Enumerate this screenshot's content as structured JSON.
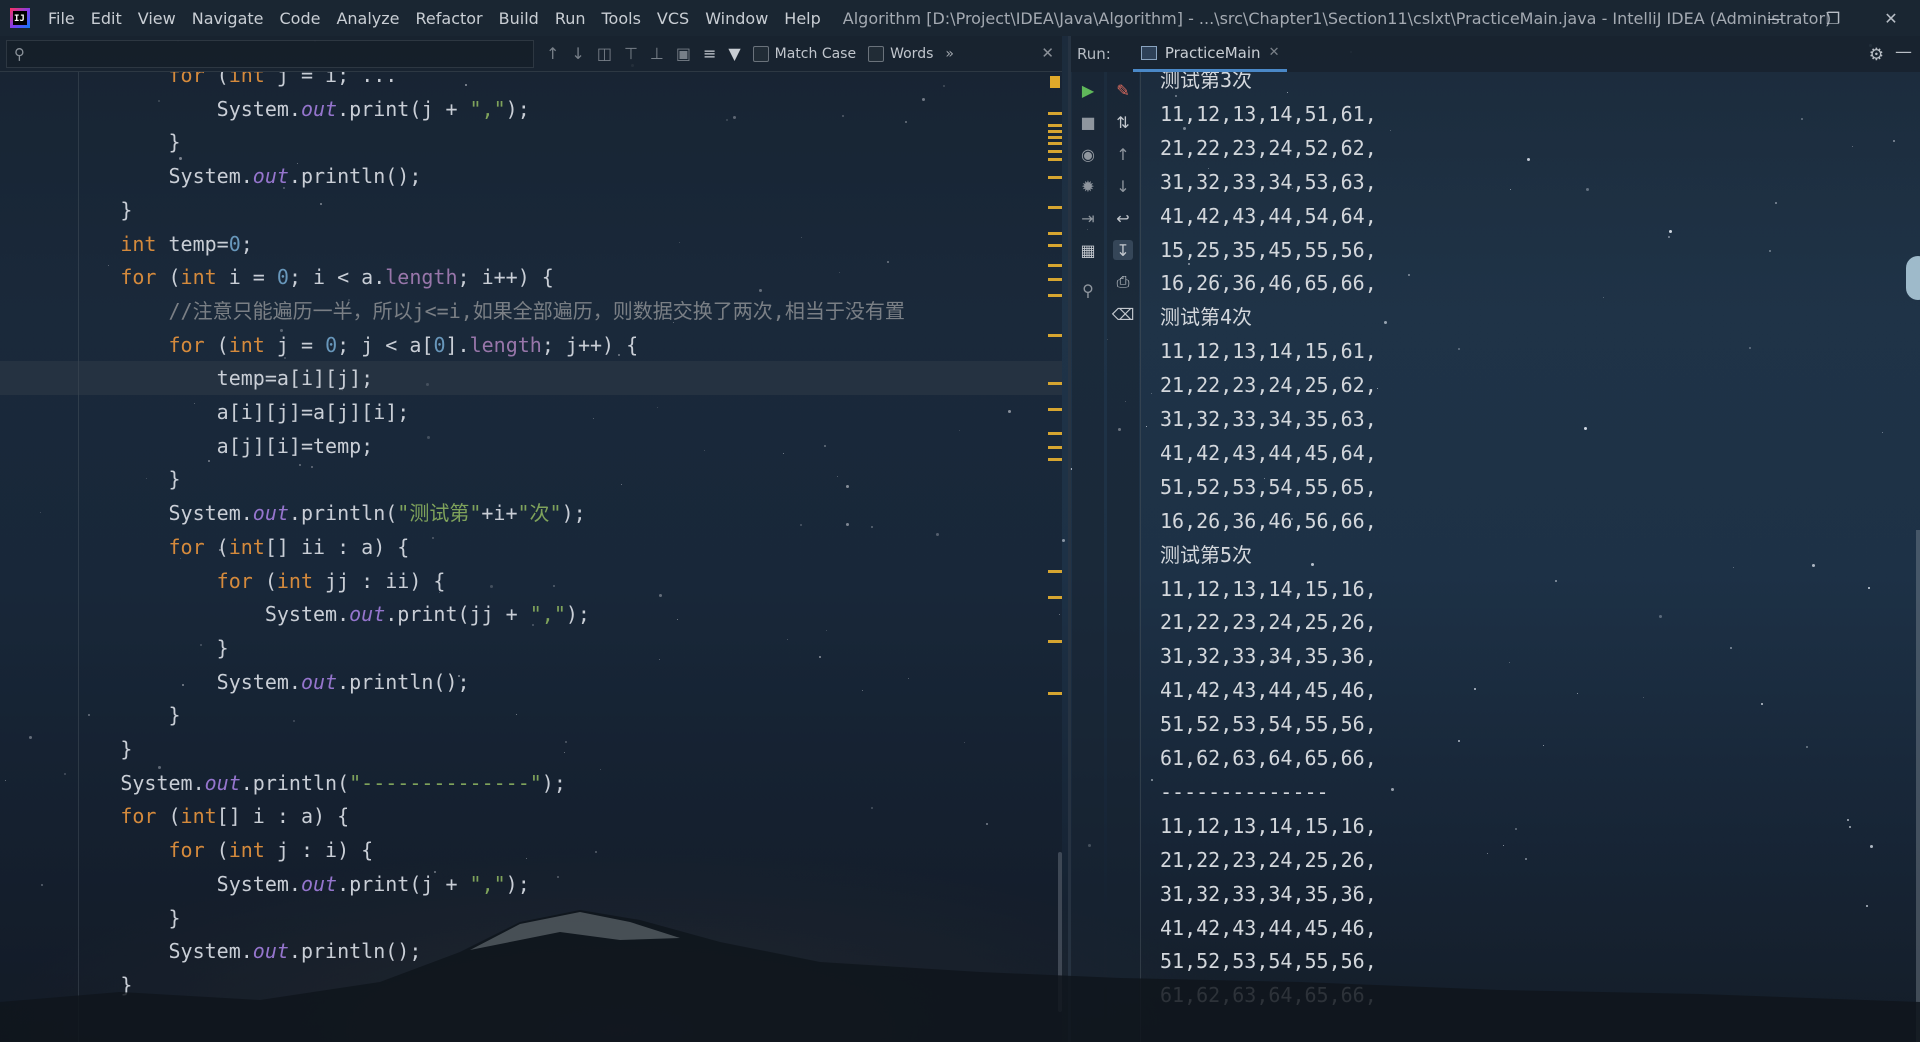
{
  "menubar": {
    "items": [
      "File",
      "Edit",
      "View",
      "Navigate",
      "Code",
      "Analyze",
      "Refactor",
      "Build",
      "Run",
      "Tools",
      "VCS",
      "Window",
      "Help"
    ],
    "window_title": "Algorithm [D:\\Project\\IDEA\\Java\\Algorithm] - ...\\src\\Chapter1\\Section11\\cslxt\\PracticeMain.java - IntelliJ IDEA (Administrator)"
  },
  "findbar": {
    "match_case_label": "Match Case",
    "words_label": "Words",
    "more_label": "»"
  },
  "editor": {
    "lines": [
      {
        "indent": 4,
        "tokens": [
          [
            "kw",
            "for "
          ],
          [
            "",
            "("
          ],
          [
            "kw",
            "int "
          ],
          [
            "",
            "j = i; "
          ],
          [
            "",
            "..."
          ]
        ]
      },
      {
        "indent": 5,
        "tokens": [
          [
            "",
            "System."
          ],
          [
            "fld",
            "out"
          ],
          [
            "",
            ".print(j + "
          ],
          [
            "str",
            "\",\""
          ],
          [
            "",
            ");"
          ]
        ]
      },
      {
        "indent": 4,
        "tokens": [
          [
            "",
            "}"
          ]
        ]
      },
      {
        "indent": 4,
        "tokens": [
          [
            "",
            "System."
          ],
          [
            "fld",
            "out"
          ],
          [
            "",
            ".println();"
          ]
        ]
      },
      {
        "indent": 3,
        "tokens": [
          [
            "",
            "}"
          ]
        ]
      },
      {
        "indent": 3,
        "tokens": [
          [
            "kw",
            "int "
          ],
          [
            "",
            "temp="
          ],
          [
            "num",
            "0"
          ],
          [
            "",
            ";"
          ]
        ]
      },
      {
        "indent": 3,
        "tokens": [
          [
            "kw",
            "for "
          ],
          [
            "",
            "("
          ],
          [
            "kw",
            "int "
          ],
          [
            "",
            "i = "
          ],
          [
            "num",
            "0"
          ],
          [
            "",
            "; i < a."
          ],
          [
            "prop",
            "length"
          ],
          [
            "",
            "; i++) {"
          ]
        ]
      },
      {
        "indent": 4,
        "tokens": [
          [
            "cmt",
            "//注意只能遍历一半，所以j<=i,如果全部遍历，则数据交换了两次,相当于没有置"
          ]
        ]
      },
      {
        "indent": 4,
        "tokens": [
          [
            "kw",
            "for "
          ],
          [
            "",
            "("
          ],
          [
            "kw",
            "int "
          ],
          [
            "",
            "j = "
          ],
          [
            "num",
            "0"
          ],
          [
            "",
            "; j < a["
          ],
          [
            "num",
            "0"
          ],
          [
            "",
            "]."
          ],
          [
            "prop",
            "length"
          ],
          [
            "",
            "; j++) {"
          ]
        ]
      },
      {
        "indent": 5,
        "tokens": [
          [
            "",
            "temp=a[i][j];"
          ]
        ]
      },
      {
        "indent": 5,
        "tokens": [
          [
            "",
            "a[i][j]=a[j][i];"
          ]
        ]
      },
      {
        "indent": 5,
        "tokens": [
          [
            "",
            "a[j][i]=temp;"
          ]
        ]
      },
      {
        "indent": 4,
        "tokens": [
          [
            "",
            "}"
          ]
        ]
      },
      {
        "indent": 4,
        "tokens": [
          [
            "",
            "System."
          ],
          [
            "fld",
            "out"
          ],
          [
            "",
            ".println("
          ],
          [
            "str",
            "\"测试第\""
          ],
          [
            "",
            "+i+"
          ],
          [
            "str",
            "\"次\""
          ],
          [
            "",
            ");"
          ]
        ]
      },
      {
        "indent": 4,
        "tokens": [
          [
            "kw",
            "for "
          ],
          [
            "",
            "("
          ],
          [
            "kw",
            "int"
          ],
          [
            "",
            "[] ii : a) {"
          ]
        ]
      },
      {
        "indent": 5,
        "tokens": [
          [
            "kw",
            "for "
          ],
          [
            "",
            "("
          ],
          [
            "kw",
            "int "
          ],
          [
            "",
            "jj : ii) {"
          ]
        ]
      },
      {
        "indent": 6,
        "tokens": [
          [
            "",
            "System."
          ],
          [
            "fld",
            "out"
          ],
          [
            "",
            ".print(jj + "
          ],
          [
            "str",
            "\",\""
          ],
          [
            "",
            ");"
          ]
        ]
      },
      {
        "indent": 5,
        "tokens": [
          [
            "",
            "}"
          ]
        ]
      },
      {
        "indent": 5,
        "tokens": [
          [
            "",
            "System."
          ],
          [
            "fld",
            "out"
          ],
          [
            "",
            ".println();"
          ]
        ]
      },
      {
        "indent": 4,
        "tokens": [
          [
            "",
            "}"
          ]
        ]
      },
      {
        "indent": 3,
        "tokens": [
          [
            "",
            "}"
          ]
        ]
      },
      {
        "indent": 3,
        "tokens": [
          [
            "",
            "System."
          ],
          [
            "fld",
            "out"
          ],
          [
            "",
            ".println("
          ],
          [
            "str",
            "\"--------------\""
          ],
          [
            "",
            ");"
          ]
        ]
      },
      {
        "indent": 3,
        "tokens": [
          [
            "kw",
            "for "
          ],
          [
            "",
            "("
          ],
          [
            "kw",
            "int"
          ],
          [
            "",
            "[] i : a) {"
          ]
        ]
      },
      {
        "indent": 4,
        "tokens": [
          [
            "kw",
            "for "
          ],
          [
            "",
            "("
          ],
          [
            "kw",
            "int "
          ],
          [
            "",
            "j : i) {"
          ]
        ]
      },
      {
        "indent": 5,
        "tokens": [
          [
            "",
            "System."
          ],
          [
            "fld",
            "out"
          ],
          [
            "",
            ".print(j + "
          ],
          [
            "str",
            "\",\""
          ],
          [
            "",
            ");"
          ]
        ]
      },
      {
        "indent": 4,
        "tokens": [
          [
            "",
            "}"
          ]
        ]
      },
      {
        "indent": 4,
        "tokens": [
          [
            "",
            "System."
          ],
          [
            "fld",
            "out"
          ],
          [
            "",
            ".println();"
          ]
        ]
      },
      {
        "indent": 3,
        "tokens": [
          [
            "",
            "}"
          ]
        ]
      }
    ],
    "current_line": 9
  },
  "run_panel": {
    "label": "Run:",
    "tab_name": "PracticeMain",
    "console_lines": [
      "测试第3次",
      "11,12,13,14,51,61,",
      "21,22,23,24,52,62,",
      "31,32,33,34,53,63,",
      "41,42,43,44,54,64,",
      "15,25,35,45,55,56,",
      "16,26,36,46,65,66,",
      "测试第4次",
      "11,12,13,14,15,61,",
      "21,22,23,24,25,62,",
      "31,32,33,34,35,63,",
      "41,42,43,44,45,64,",
      "51,52,53,54,55,65,",
      "16,26,36,46,56,66,",
      "测试第5次",
      "11,12,13,14,15,16,",
      "21,22,23,24,25,26,",
      "31,32,33,34,35,36,",
      "41,42,43,44,45,46,",
      "51,52,53,54,55,56,",
      "61,62,63,64,65,66,",
      "--------------",
      "11,12,13,14,15,16,",
      "21,22,23,24,25,26,",
      "31,32,33,34,35,36,",
      "41,42,43,44,45,46,",
      "51,52,53,54,55,56,",
      "61,62,63,64,65,66,"
    ]
  },
  "colors": {
    "keyword": "#d58a3c",
    "string": "#7fa35b",
    "number": "#6897bb",
    "static_field": "#9575cd",
    "comment": "#7a7f85",
    "stripe_mark": "#d6a530",
    "tab_underline": "#4a88c7"
  },
  "icons": {
    "run_toolbar_left": [
      "rerun-icon",
      "stop-icon",
      "camera-icon",
      "debug-icon",
      "exit-icon",
      "layout-icon",
      "pin-icon"
    ],
    "run_toolbar_right": [
      "clear-icon",
      "sort-icon",
      "up-icon",
      "down-icon",
      "soft-wrap-icon",
      "scroll-end-icon",
      "print-icon",
      "trash-icon"
    ]
  }
}
